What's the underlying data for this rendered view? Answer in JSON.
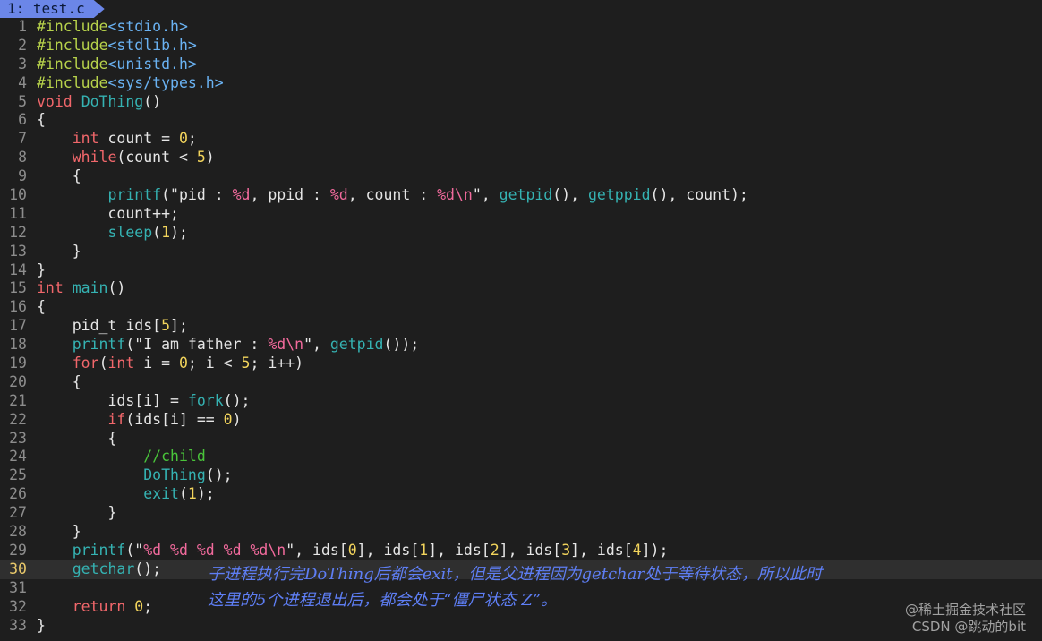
{
  "tab": {
    "label": "1: test.c"
  },
  "colors": {
    "background": "#1e1e1e",
    "tab_bg": "#6b86e8",
    "keyword": "#f1676b",
    "function": "#35b2b2",
    "preproc": "#b7d24b",
    "include_path": "#6ab2f2",
    "number": "#f2d45c",
    "format_spec": "#f16a9c",
    "comment": "#49c43a",
    "annotation": "#5e7ef4",
    "current_line_number": "#e8c86a"
  },
  "editor": {
    "current_line": 30,
    "lines": [
      {
        "n": "1",
        "tokens": [
          [
            "pre",
            "#include"
          ],
          [
            "inc",
            "<stdio.h>"
          ]
        ]
      },
      {
        "n": "2",
        "tokens": [
          [
            "pre",
            "#include"
          ],
          [
            "inc",
            "<stdlib.h>"
          ]
        ]
      },
      {
        "n": "3",
        "tokens": [
          [
            "pre",
            "#include"
          ],
          [
            "inc",
            "<unistd.h>"
          ]
        ]
      },
      {
        "n": "4",
        "tokens": [
          [
            "pre",
            "#include"
          ],
          [
            "inc",
            "<sys/types.h>"
          ]
        ]
      },
      {
        "n": "5",
        "tokens": [
          [
            "kw",
            "void"
          ],
          [
            "pn",
            " "
          ],
          [
            "fn",
            "DoThing"
          ],
          [
            "pn",
            "()"
          ]
        ]
      },
      {
        "n": "6",
        "tokens": [
          [
            "pn",
            "{"
          ]
        ]
      },
      {
        "n": "7",
        "tokens": [
          [
            "pn",
            "    "
          ],
          [
            "kw",
            "int"
          ],
          [
            "pn",
            " count = "
          ],
          [
            "num",
            "0"
          ],
          [
            "pn",
            ";"
          ]
        ]
      },
      {
        "n": "8",
        "tokens": [
          [
            "pn",
            "    "
          ],
          [
            "kw",
            "while"
          ],
          [
            "pn",
            "(count < "
          ],
          [
            "num",
            "5"
          ],
          [
            "pn",
            ")"
          ]
        ]
      },
      {
        "n": "9",
        "tokens": [
          [
            "pn",
            "    {"
          ]
        ]
      },
      {
        "n": "10",
        "tokens": [
          [
            "pn",
            "        "
          ],
          [
            "fn",
            "printf"
          ],
          [
            "pn",
            "("
          ],
          [
            "str",
            "\"pid : "
          ],
          [
            "fmt",
            "%d"
          ],
          [
            "str",
            ", ppid : "
          ],
          [
            "fmt",
            "%d"
          ],
          [
            "str",
            ", count : "
          ],
          [
            "fmt",
            "%d\\n"
          ],
          [
            "str",
            "\""
          ],
          [
            "pn",
            ", "
          ],
          [
            "fn",
            "getpid"
          ],
          [
            "pn",
            "(), "
          ],
          [
            "fn",
            "getppid"
          ],
          [
            "pn",
            "(), count);"
          ]
        ]
      },
      {
        "n": "11",
        "tokens": [
          [
            "pn",
            "        count++;"
          ]
        ]
      },
      {
        "n": "12",
        "tokens": [
          [
            "pn",
            "        "
          ],
          [
            "fn",
            "sleep"
          ],
          [
            "pn",
            "("
          ],
          [
            "num",
            "1"
          ],
          [
            "pn",
            ");"
          ]
        ]
      },
      {
        "n": "13",
        "tokens": [
          [
            "pn",
            "    }"
          ]
        ]
      },
      {
        "n": "14",
        "tokens": [
          [
            "pn",
            "}"
          ]
        ]
      },
      {
        "n": "15",
        "tokens": [
          [
            "kw",
            "int"
          ],
          [
            "pn",
            " "
          ],
          [
            "fn",
            "main"
          ],
          [
            "pn",
            "()"
          ]
        ]
      },
      {
        "n": "16",
        "tokens": [
          [
            "pn",
            "{"
          ]
        ]
      },
      {
        "n": "17",
        "tokens": [
          [
            "pn",
            "    pid_t ids["
          ],
          [
            "num",
            "5"
          ],
          [
            "pn",
            "];"
          ]
        ]
      },
      {
        "n": "18",
        "tokens": [
          [
            "pn",
            "    "
          ],
          [
            "fn",
            "printf"
          ],
          [
            "pn",
            "("
          ],
          [
            "str",
            "\"I am father : "
          ],
          [
            "fmt",
            "%d\\n"
          ],
          [
            "str",
            "\""
          ],
          [
            "pn",
            ", "
          ],
          [
            "fn",
            "getpid"
          ],
          [
            "pn",
            "());"
          ]
        ]
      },
      {
        "n": "19",
        "tokens": [
          [
            "pn",
            "    "
          ],
          [
            "kw",
            "for"
          ],
          [
            "pn",
            "("
          ],
          [
            "kw",
            "int"
          ],
          [
            "pn",
            " i = "
          ],
          [
            "num",
            "0"
          ],
          [
            "pn",
            "; i < "
          ],
          [
            "num",
            "5"
          ],
          [
            "pn",
            "; i++)"
          ]
        ]
      },
      {
        "n": "20",
        "tokens": [
          [
            "pn",
            "    {"
          ]
        ]
      },
      {
        "n": "21",
        "tokens": [
          [
            "pn",
            "        ids[i] = "
          ],
          [
            "fn",
            "fork"
          ],
          [
            "pn",
            "();"
          ]
        ]
      },
      {
        "n": "22",
        "tokens": [
          [
            "pn",
            "        "
          ],
          [
            "kw",
            "if"
          ],
          [
            "pn",
            "(ids[i] == "
          ],
          [
            "num",
            "0"
          ],
          [
            "pn",
            ")"
          ]
        ]
      },
      {
        "n": "23",
        "tokens": [
          [
            "pn",
            "        {"
          ]
        ]
      },
      {
        "n": "24",
        "tokens": [
          [
            "pn",
            "            "
          ],
          [
            "cmt",
            "//child"
          ]
        ]
      },
      {
        "n": "25",
        "tokens": [
          [
            "pn",
            "            "
          ],
          [
            "fn",
            "DoThing"
          ],
          [
            "pn",
            "();"
          ]
        ]
      },
      {
        "n": "26",
        "tokens": [
          [
            "pn",
            "            "
          ],
          [
            "fn",
            "exit"
          ],
          [
            "pn",
            "("
          ],
          [
            "num",
            "1"
          ],
          [
            "pn",
            ");"
          ]
        ]
      },
      {
        "n": "27",
        "tokens": [
          [
            "pn",
            "        }"
          ]
        ]
      },
      {
        "n": "28",
        "tokens": [
          [
            "pn",
            "    }"
          ]
        ]
      },
      {
        "n": "29",
        "tokens": [
          [
            "pn",
            "    "
          ],
          [
            "fn",
            "printf"
          ],
          [
            "pn",
            "("
          ],
          [
            "str",
            "\""
          ],
          [
            "fmt",
            "%d %d %d %d %d\\n"
          ],
          [
            "str",
            "\""
          ],
          [
            "pn",
            ", ids["
          ],
          [
            "num",
            "0"
          ],
          [
            "pn",
            "], ids["
          ],
          [
            "num",
            "1"
          ],
          [
            "pn",
            "], ids["
          ],
          [
            "num",
            "2"
          ],
          [
            "pn",
            "], ids["
          ],
          [
            "num",
            "3"
          ],
          [
            "pn",
            "], ids["
          ],
          [
            "num",
            "4"
          ],
          [
            "pn",
            "]);"
          ]
        ]
      },
      {
        "n": "30",
        "tokens": [
          [
            "pn",
            "    "
          ],
          [
            "fn",
            "getchar"
          ],
          [
            "pn",
            "();"
          ]
        ]
      },
      {
        "n": "31",
        "tokens": []
      },
      {
        "n": "32",
        "tokens": [
          [
            "pn",
            "    "
          ],
          [
            "kw",
            "return"
          ],
          [
            "pn",
            " "
          ],
          [
            "num",
            "0"
          ],
          [
            "pn",
            ";"
          ]
        ]
      },
      {
        "n": "33",
        "tokens": [
          [
            "pn",
            "}"
          ]
        ]
      }
    ]
  },
  "annotation": {
    "line1": "子进程执行完DoThing后都会exit，但是父进程因为getchar处于等待状态，所以此时",
    "line2": "这里的5个进程退出后，都会处于“僵尸状态 Z”。"
  },
  "watermark": {
    "line1": "@稀土掘金技术社区",
    "line2": "CSDN @跳动的bit"
  }
}
